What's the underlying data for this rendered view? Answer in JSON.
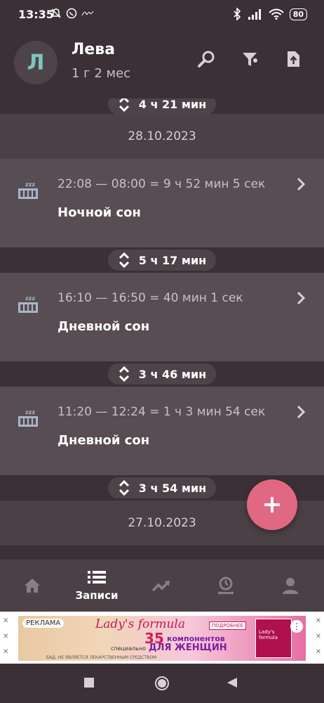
{
  "status": {
    "time": "13:35",
    "battery": "80"
  },
  "header": {
    "avatar_letter": "Л",
    "name": "Лева",
    "age": "1 г  2 мес",
    "icons": [
      "search-icon",
      "filter-icon",
      "export-icon"
    ]
  },
  "timeline": {
    "gap1": "4 ч 21 мин",
    "date1": "28.10.2023",
    "entry1": {
      "time": "22:08 — 08:00 = 9 ч 52 мин 5 сек",
      "label": "Ночной сон"
    },
    "gap2": "5 ч 17 мин",
    "entry2": {
      "time": "16:10 — 16:50 = 40 мин 1 сек",
      "label": "Дневной сон"
    },
    "gap3": "3 ч 46 мин",
    "entry3": {
      "time": "11:20 — 12:24 = 1 ч 3 мин 54 сек",
      "label": "Дневной сон"
    },
    "gap4": "3 ч 54 мин",
    "date2": "27.10.2023"
  },
  "bottom_nav": {
    "active_label": "Записи",
    "items": [
      "home-icon",
      "list-icon",
      "trend-icon",
      "timer-icon",
      "profile-icon"
    ]
  },
  "ad": {
    "tag": "РЕКЛАМА",
    "brand": "Lady's formula",
    "badge": "ПОДРОБНЕЕ",
    "number": "35",
    "components": "компонентов",
    "special": "специально",
    "for_women": "ДЛЯ ЖЕНЩИН",
    "footer": "БАД. НЕ ЯВЛЯЕТСЯ ЛЕКАРСТВЕННЫМ СРЕДСТВОМ",
    "box_text": "Lady's formula"
  },
  "colors": {
    "background": "#3a3036",
    "card": "#574d53",
    "fab": "#e16882",
    "avatar_letter": "#7ec4c1"
  }
}
